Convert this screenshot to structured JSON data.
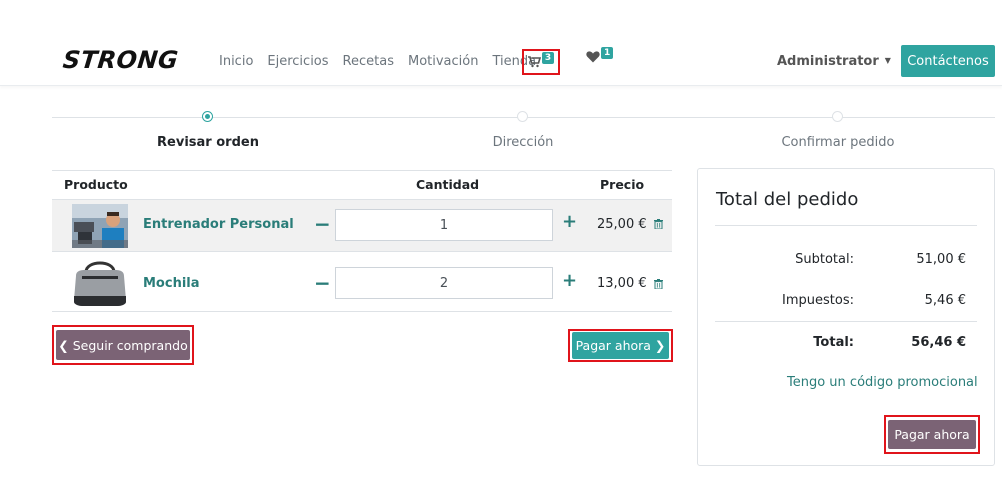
{
  "header": {
    "logo": "STRONG",
    "nav": [
      "Inicio",
      "Ejercicios",
      "Recetas",
      "Motivación",
      "Tienda"
    ],
    "cart_count": "3",
    "wishlist_count": "1",
    "user": "Administrator",
    "contact_label": "Contáctenos"
  },
  "steps": [
    {
      "label": "Revisar orden",
      "active": true
    },
    {
      "label": "Dirección",
      "active": false
    },
    {
      "label": "Confirmar pedido",
      "active": false
    }
  ],
  "table": {
    "headers": {
      "product": "Producto",
      "quantity": "Cantidad",
      "price": "Precio"
    },
    "rows": [
      {
        "name": "Entrenador Personal",
        "qty": "1",
        "price": "25,00 €",
        "image": "trainer-photo"
      },
      {
        "name": "Mochila",
        "qty": "2",
        "price": "13,00 €",
        "image": "backpack-photo"
      }
    ]
  },
  "actions": {
    "continue_label": "Seguir comprando",
    "pay_label": "Pagar ahora"
  },
  "summary": {
    "title": "Total del pedido",
    "subtotal_label": "Subtotal:",
    "subtotal": "51,00 €",
    "taxes_label": "Impuestos:",
    "taxes": "5,46 €",
    "total_label": "Total:",
    "total": "56,46 €",
    "promo_label": "Tengo un código promocional",
    "pay_label": "Pagar ahora"
  },
  "colors": {
    "accent": "#2fa4a0",
    "secondary": "#7b6375",
    "link": "#2a7d79",
    "highlight": "#e0141b"
  }
}
